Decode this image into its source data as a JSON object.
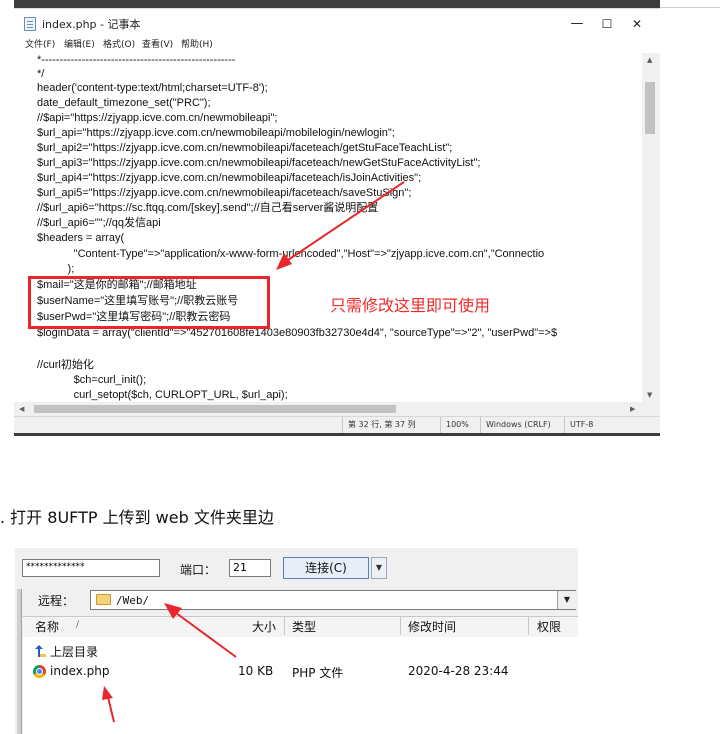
{
  "notepad": {
    "title": "index.php - 记事本",
    "window_controls": {
      "minimize": "—",
      "maximize": "☐",
      "close": "✕"
    },
    "menus": [
      "文件(F)",
      "编辑(E)",
      "格式(O)",
      "查看(V)",
      "帮助(H)"
    ],
    "code_lines": [
      "*-----------------------------------------------------",
      "*/",
      "header('content-type:text/html;charset=UTF-8');",
      "date_default_timezone_set(\"PRC\");",
      "//$api=\"https://zjyapp.icve.com.cn/newmobileapi\";",
      "$url_api=\"https://zjyapp.icve.com.cn/newmobileapi/mobilelogin/newlogin\";",
      "$url_api2=\"https://zjyapp.icve.com.cn/newmobileapi/faceteach/getStuFaceTeachList\";",
      "$url_api3=\"https://zjyapp.icve.com.cn/newmobileapi/faceteach/newGetStuFaceActivityList\";",
      "$url_api4=\"https://zjyapp.icve.com.cn/newmobileapi/faceteach/isJoinActivities\";",
      "$url_api5=\"https://zjyapp.icve.com.cn/newmobileapi/faceteach/saveStuSign\";",
      "//$url_api6=\"https://sc.ftqq.com/[skey].send\";//自己看server酱说明配置",
      "//$url_api6=\"\";//qq发信api",
      "$headers = array(",
      "            \"Content-Type\"=>\"application/x-www-form-urlencoded\",\"Host\"=>\"zjyapp.icve.com.cn\",\"Connectio",
      "          );",
      "$mail=\"这是你的邮箱\";//邮箱地址",
      "$userName=\"这里填写账号\";//职教云账号",
      "$userPwd=\"这里填写密码\";//职教云密码",
      "$loginData = array(\"clientId\"=>\"452701608fe1403e80903fb32730e4d4\", \"sourceType\"=>\"2\", \"userPwd\"=>$",
      "",
      "//curl初始化",
      "            $ch=curl_init();",
      "            curl_setopt($ch, CURLOPT_URL, $url_api);"
    ],
    "status": {
      "position": "第 32 行, 第 37 列",
      "zoom": "100%",
      "line_ending": "Windows (CRLF)",
      "encoding": "UTF-8"
    },
    "annotation": "只需修改这里即可使用",
    "colors": {
      "annotation": "#e8262b"
    }
  },
  "instruction": ". 打开 8UFTP 上传到 web 文件夹里边",
  "ftp": {
    "password_masked": "*************",
    "port_label": "端口：",
    "port_value": "21",
    "connect_label": "连接(C)",
    "remote_label": "远程：",
    "remote_path": "/Web/",
    "columns": {
      "name": "名称",
      "sort": "/",
      "size": "大小",
      "type": "类型",
      "modified": "修改时间",
      "permissions": "权限"
    },
    "parent_dir": "上层目录",
    "files": [
      {
        "name": "index.php",
        "size": "10 KB",
        "type": "PHP 文件",
        "modified": "2020-4-28 23:44"
      }
    ]
  }
}
